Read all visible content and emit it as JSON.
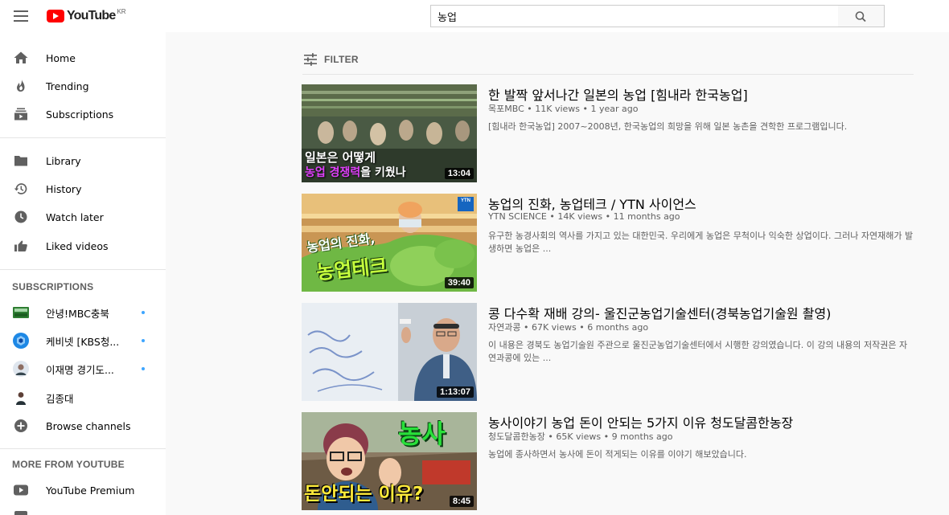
{
  "header": {
    "logo_text": "YouTube",
    "logo_region": "KR",
    "search_value": "농업",
    "search_placeholder": "Search"
  },
  "sidebar": {
    "main": [
      {
        "label": "Home",
        "icon": "home-icon"
      },
      {
        "label": "Trending",
        "icon": "fire-icon"
      },
      {
        "label": "Subscriptions",
        "icon": "subscriptions-icon"
      }
    ],
    "library": [
      {
        "label": "Library",
        "icon": "folder-icon"
      },
      {
        "label": "History",
        "icon": "history-icon"
      },
      {
        "label": "Watch later",
        "icon": "clock-icon"
      },
      {
        "label": "Liked videos",
        "icon": "thumbs-up-icon"
      }
    ],
    "subscriptions_title": "SUBSCRIPTIONS",
    "subscriptions": [
      {
        "label": "안녕!MBC충북",
        "new": true
      },
      {
        "label": "케비넷 [KBS청...",
        "new": true
      },
      {
        "label": "이재명 경기도...",
        "new": true
      },
      {
        "label": "김종대",
        "new": false
      },
      {
        "label": "Browse channels",
        "new": false
      }
    ],
    "more_title": "MORE FROM YOUTUBE",
    "more": [
      {
        "label": "YouTube Premium",
        "icon": "youtube-premium-icon"
      }
    ]
  },
  "filter": {
    "label": "FILTER",
    "icon": "filter-icon"
  },
  "results": [
    {
      "title": "한 발짝 앞서나간 일본의 농업 [힘내라 한국농업]",
      "channel": "목포MBC",
      "views": "11K views",
      "age": "1 year ago",
      "description": "[힘내라 한국농업] 2007~2008년, 한국농업의 희망을 위해 일본 농촌을 견학한 프로그램입니다.",
      "duration": "13:04",
      "thumb_text_1": "일본은 어떻게",
      "thumb_text_2a": "농업 경쟁력",
      "thumb_text_2b": "을 키웠나"
    },
    {
      "title": "농업의 진화, 농업테크 / YTN 사이언스",
      "channel": "YTN SCIENCE",
      "views": "14K views",
      "age": "11 months ago",
      "description": "유구한 농경사회의 역사를 가지고 있는 대한민국. 우리에게 농업은 무척이나 익숙한 상업이다. 그러나 자연재해가 발생하면 농업은 ...",
      "duration": "39:40",
      "thumb_text_1": "농업의 진화,",
      "thumb_text_2": "농업테크",
      "thumb_badge": "YTN"
    },
    {
      "title": "콩 다수확 재배 강의- 울진군농업기술센터(경북농업기술원 촬영)",
      "channel": "자연과콩",
      "views": "67K views",
      "age": "6 months ago",
      "description": "이 내용은 경북도 농업기술원 주관으로 울진군농업기술센터에서 시행한 강의였습니다. 이 강의 내용의 저작권은 자연과콩에 있는 ...",
      "duration": "1:13:07"
    },
    {
      "title": "농사이야기 농업 돈이 안되는 5가지 이유 청도달콤한농장",
      "channel": "청도달콤한농장",
      "views": "65K views",
      "age": "9 months ago",
      "description": "농업에 종사하면서 농사에 돈이 적게되는 이유를 이야기 해보았습니다.",
      "duration": "8:45",
      "thumb_text_1": "농사",
      "thumb_text_2": "돈안되는 이유?"
    }
  ],
  "colors": {
    "brand_red": "#ff0000",
    "new_dot": "#3ea6ff",
    "text_primary": "#030303",
    "text_secondary": "#606060"
  }
}
